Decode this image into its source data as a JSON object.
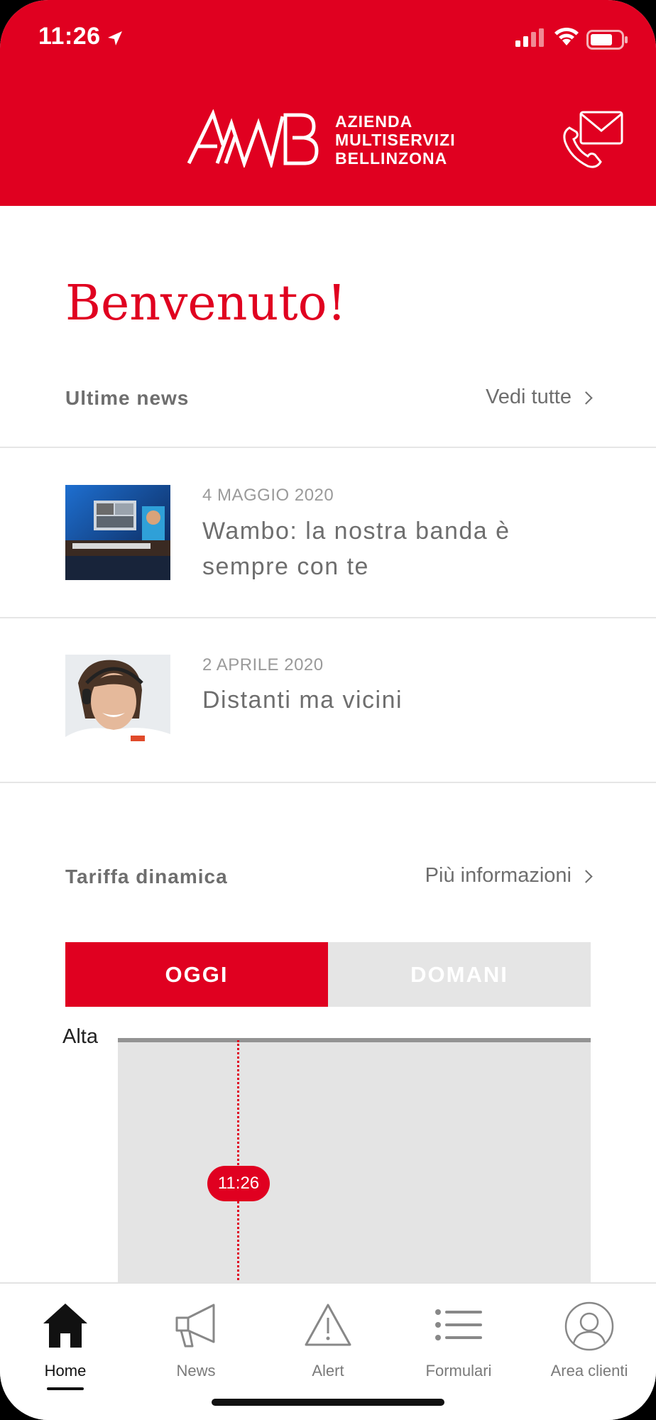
{
  "status_bar": {
    "time": "11:26",
    "icons": [
      "location-arrow-icon",
      "signal-icon",
      "wifi-icon",
      "battery-icon"
    ]
  },
  "header": {
    "logo_mark": "AMB",
    "logo_lines": [
      "AZIENDA",
      "MULTISERVIZI",
      "BELLINZONA"
    ],
    "contact_icon": "phone-mail-icon",
    "background_color": "#e00020"
  },
  "main": {
    "welcome_title": "Benvenuto!",
    "news_section": {
      "title": "Ultime news",
      "link_label": "Vedi tutte",
      "items": [
        {
          "date": "4 MAGGIO 2020",
          "title": "Wambo: la nostra banda è sempre con te"
        },
        {
          "date": "2 APRILE 2020",
          "title": "Distanti ma vicini"
        }
      ]
    },
    "tariff_section": {
      "title": "Tariffa dinamica",
      "link_label": "Più informazioni",
      "tabs": [
        {
          "label": "OGGI",
          "active": true
        },
        {
          "label": "DOMANI",
          "active": false
        }
      ],
      "chart": {
        "y_label": "Alta",
        "current_time": "11:26"
      }
    }
  },
  "tabbar": {
    "items": [
      {
        "label": "Home",
        "icon": "home-icon",
        "active": true
      },
      {
        "label": "News",
        "icon": "megaphone-icon",
        "active": false
      },
      {
        "label": "Alert",
        "icon": "warning-icon",
        "active": false
      },
      {
        "label": "Formulari",
        "icon": "list-icon",
        "active": false
      },
      {
        "label": "Area clienti",
        "icon": "user-icon",
        "active": false
      }
    ]
  },
  "colors": {
    "brand_red": "#e00020",
    "text_gray": "#6e6e6e",
    "date_gray": "#9a9a9a"
  }
}
